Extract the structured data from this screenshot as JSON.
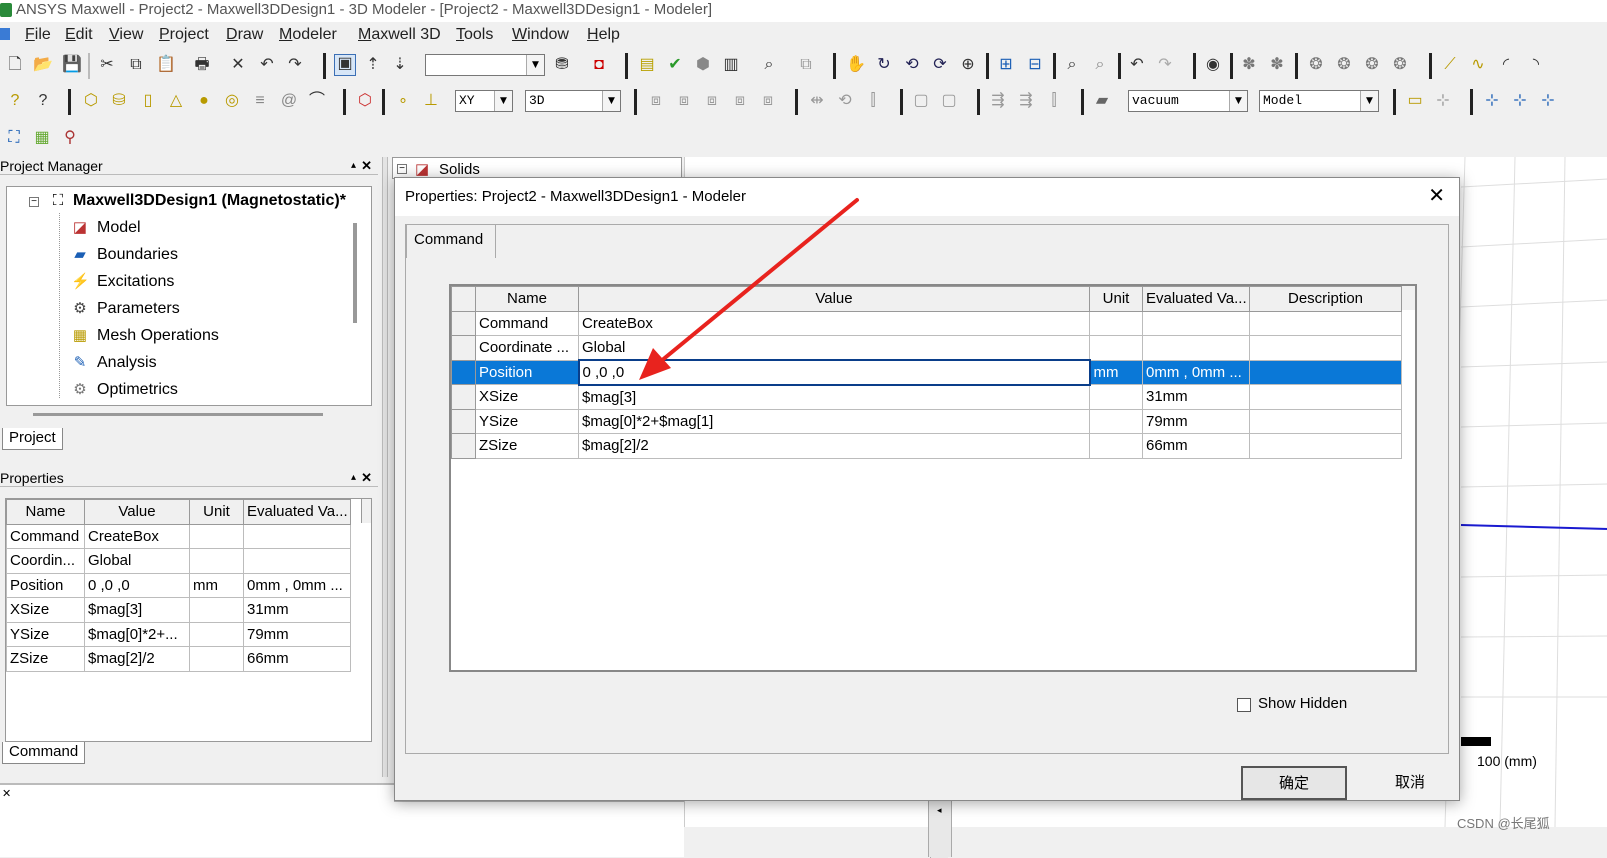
{
  "window": {
    "title": "ANSYS Maxwell - Project2 - Maxwell3DDesign1 - 3D Modeler - [Project2 - Maxwell3DDesign1 - Modeler]"
  },
  "menu": [
    "File",
    "Edit",
    "View",
    "Project",
    "Draw",
    "Modeler",
    "Maxwell 3D",
    "Tools",
    "Window",
    "Help"
  ],
  "toolbar": {
    "plane": "XY",
    "dimension": "3D",
    "material": "vacuum",
    "model": "Model"
  },
  "project_manager": {
    "title": "Project Manager",
    "root": "Maxwell3DDesign1 (Magnetostatic)*",
    "items": [
      "Model",
      "Boundaries",
      "Excitations",
      "Parameters",
      "Mesh Operations",
      "Analysis",
      "Optimetrics"
    ],
    "tab": "Project"
  },
  "properties_panel": {
    "title": "Properties",
    "headers": [
      "Name",
      "Value",
      "Unit",
      "Evaluated Va..."
    ],
    "rows": [
      [
        "Command",
        "CreateBox",
        "",
        ""
      ],
      [
        "Coordin...",
        "Global",
        "",
        ""
      ],
      [
        "Position",
        "0 ,0 ,0",
        "mm",
        "0mm , 0mm ..."
      ],
      [
        "XSize",
        "$mag[3]",
        "",
        "31mm"
      ],
      [
        "YSize",
        "$mag[0]*2+...",
        "",
        "79mm"
      ],
      [
        "ZSize",
        "$mag[2]/2",
        "",
        "66mm"
      ]
    ],
    "tab": "Command"
  },
  "solids_label": "Solids",
  "dialog": {
    "title": "Properties: Project2 - Maxwell3DDesign1 - Modeler",
    "tab": "Command",
    "headers": [
      "Name",
      "Value",
      "Unit",
      "Evaluated Va...",
      "Description"
    ],
    "rows": [
      [
        "Command",
        "CreateBox",
        "",
        "",
        ""
      ],
      [
        "Coordinate ...",
        "Global",
        "",
        "",
        ""
      ],
      [
        "Position",
        "0 ,0 ,0",
        "mm",
        "0mm , 0mm ...",
        ""
      ],
      [
        "XSize",
        "$mag[3]",
        "",
        "31mm",
        ""
      ],
      [
        "YSize",
        "$mag[0]*2+$mag[1]",
        "",
        "79mm",
        ""
      ],
      [
        "ZSize",
        "$mag[2]/2",
        "",
        "66mm",
        ""
      ]
    ],
    "show_hidden_label": "Show Hidden",
    "show_hidden_checked": false,
    "ok_label": "确定",
    "cancel_label": "取消"
  },
  "viewport": {
    "scale_label": "100 (mm)"
  },
  "watermark": "CSDN @长尾狐",
  "colors": {
    "selection": "#0a78d7",
    "arrow": "#e8231e",
    "axis_line": "#1a1ad0"
  }
}
